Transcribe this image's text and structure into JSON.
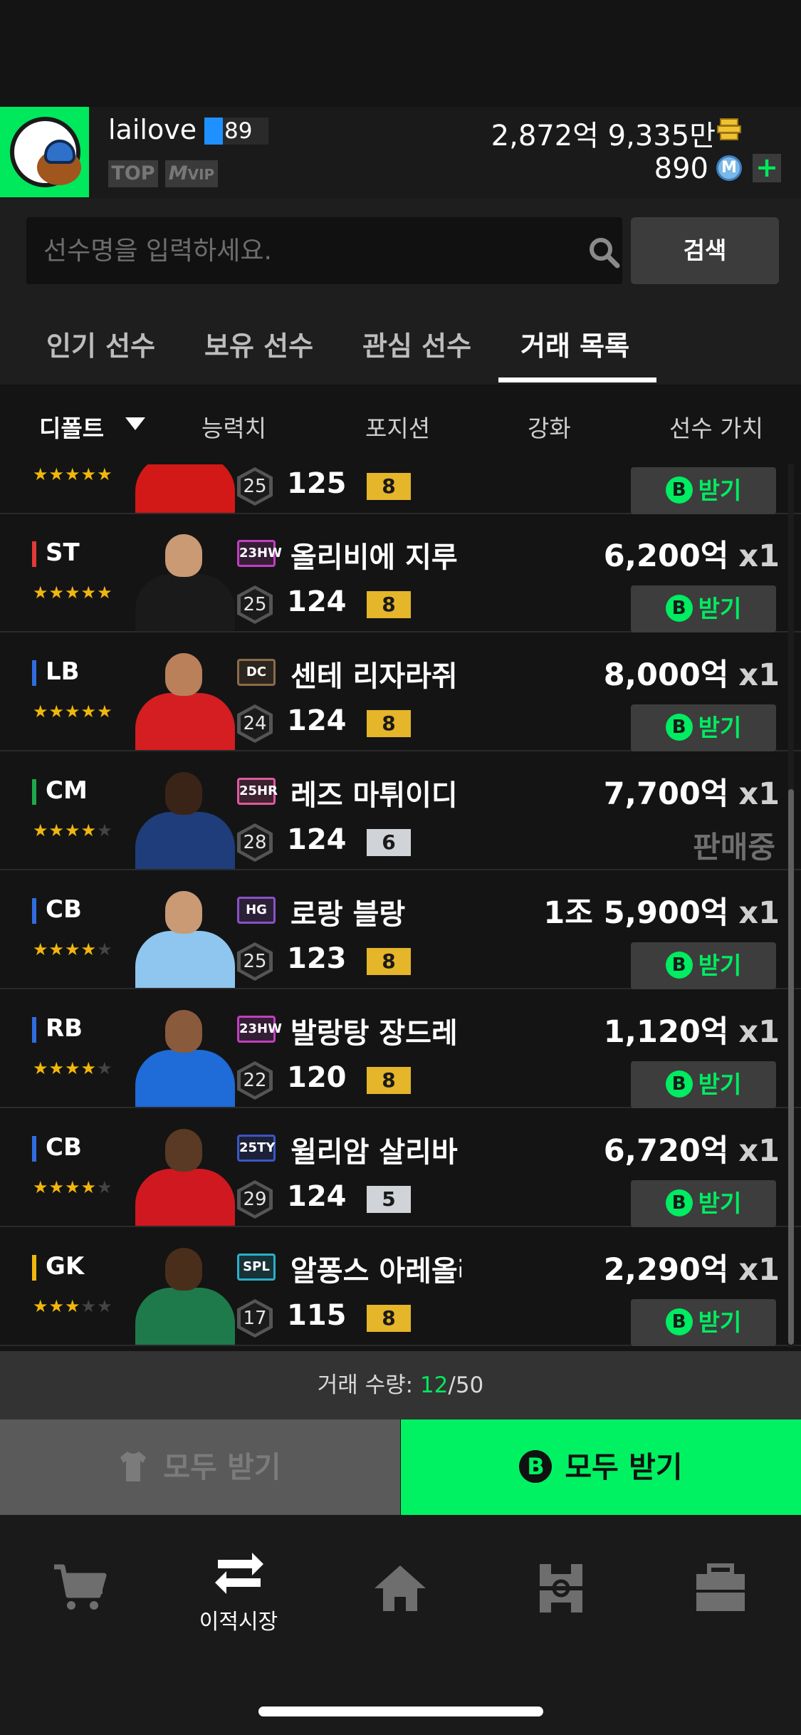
{
  "profile": {
    "username": "lailove",
    "level": "89",
    "tags": [
      "TOP",
      "VIP"
    ],
    "money": "2,872억 9,335만",
    "coins": "890",
    "plus": "+"
  },
  "search": {
    "placeholder": "선수명을 입력하세요.",
    "button": "검색"
  },
  "tabs": [
    {
      "label": "인기 선수"
    },
    {
      "label": "보유 선수"
    },
    {
      "label": "관심 선수"
    },
    {
      "label": "거래 목록",
      "active": true
    }
  ],
  "sort": {
    "default": "디폴트",
    "columns": [
      "능력치",
      "포지션",
      "강화",
      "선수 가치"
    ]
  },
  "claim_label": "받기",
  "claim_letter": "B",
  "players": [
    {
      "position": "",
      "position_color": "#e53935",
      "stars": 5,
      "name": "",
      "season": "",
      "season_color": "#e53935",
      "age": "25",
      "ovr": "125",
      "enhance": "8",
      "enhance_type": "gold",
      "price": "",
      "qty": "",
      "status": "claim",
      "kit": "#d31818",
      "skin": "#8a5a3c"
    },
    {
      "position": "ST",
      "position_color": "#e53935",
      "stars": 5,
      "name": "올리비에 지루",
      "season": "23HW",
      "season_color": "#c040c0",
      "age": "25",
      "ovr": "124",
      "enhance": "8",
      "enhance_type": "gold",
      "price": "6,200억",
      "qty": "x1",
      "status": "claim",
      "kit": "#1a1a1a",
      "skin": "#c99a74"
    },
    {
      "position": "LB",
      "position_color": "#2f6de0",
      "stars": 5,
      "name": "센테 리자라쥐",
      "season": "DC",
      "season_color": "#8b6c4a",
      "age": "24",
      "ovr": "124",
      "enhance": "8",
      "enhance_type": "gold",
      "price": "8,000억",
      "qty": "x1",
      "status": "claim",
      "kit": "#d41e22",
      "skin": "#b98059"
    },
    {
      "position": "CM",
      "position_color": "#1ea84a",
      "stars": 4,
      "name": "레즈 마튀이디",
      "season": "25HR",
      "season_color": "#e05aa0",
      "age": "28",
      "ovr": "124",
      "enhance": "6",
      "enhance_type": "silver",
      "price": "7,700억",
      "qty": "x1",
      "status": "selling",
      "status_text": "판매중",
      "kit": "#1f3d7a",
      "skin": "#3a2418"
    },
    {
      "position": "CB",
      "position_color": "#2f6de0",
      "stars": 4,
      "name": "로랑 블랑",
      "season": "HG",
      "season_color": "#8a52c8",
      "age": "25",
      "ovr": "123",
      "enhance": "8",
      "enhance_type": "gold",
      "price": "1조 5,900억",
      "qty": "x1",
      "status": "claim",
      "kit": "#8ec6ef",
      "skin": "#c99a74"
    },
    {
      "position": "RB",
      "position_color": "#2f6de0",
      "stars": 4,
      "name": "발랑탕 장드레",
      "season": "23HW",
      "season_color": "#c040c0",
      "age": "22",
      "ovr": "120",
      "enhance": "8",
      "enhance_type": "gold",
      "price": "1,120억",
      "qty": "x1",
      "status": "claim",
      "kit": "#1f6bd8",
      "skin": "#8a5a3c"
    },
    {
      "position": "CB",
      "position_color": "#2f6de0",
      "stars": 4,
      "name": "윌리암 살리바",
      "season": "25TY",
      "season_color": "#3a56c8",
      "age": "29",
      "ovr": "124",
      "enhance": "5",
      "enhance_type": "silver",
      "price": "6,720억",
      "qty": "x1",
      "status": "claim",
      "kit": "#d01820",
      "skin": "#5a3a24"
    },
    {
      "position": "GK",
      "position_color": "#f2b60d",
      "stars": 3,
      "name": "알퐁스 아레올라",
      "season": "SPL",
      "season_color": "#2ab0c8",
      "age": "17",
      "ovr": "115",
      "enhance": "8",
      "enhance_type": "gold",
      "price": "2,290억",
      "qty": "x1",
      "status": "claim",
      "kit": "#1e7a4a",
      "skin": "#4a2e1c"
    }
  ],
  "trade": {
    "label": "거래 수량: ",
    "count": "12",
    "max": "/50"
  },
  "bottom_buttons": {
    "claim_all_grey": "모두 받기",
    "claim_all_green": "모두 받기"
  },
  "nav": {
    "transfer_label": "이적시장"
  }
}
